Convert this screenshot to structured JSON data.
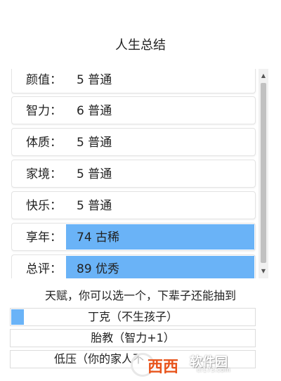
{
  "page": {
    "title": "人生总结"
  },
  "stats": [
    {
      "label": "颜值：",
      "value": "5 普通",
      "highlight": false
    },
    {
      "label": "智力：",
      "value": "6 普通",
      "highlight": false
    },
    {
      "label": "体质：",
      "value": "5 普通",
      "highlight": false
    },
    {
      "label": "家境：",
      "value": "5 普通",
      "highlight": false
    },
    {
      "label": "快乐：",
      "value": "5 普通",
      "highlight": false
    },
    {
      "label": "享年：",
      "value": "74 古稀",
      "highlight": true
    },
    {
      "label": "总评：",
      "value": "89 优秀",
      "highlight": true
    }
  ],
  "talents": {
    "prompt": "天赋，你可以选一个，下辈子还能抽到",
    "options": [
      {
        "label": "丁克（不生孩子）",
        "selected": true
      },
      {
        "label": "胎教（智力+1）",
        "selected": false
      },
      {
        "label": "低压（你的家人不",
        "selected": false
      }
    ]
  },
  "colors": {
    "highlight": "#6ab3f7",
    "border": "#e3e3e3",
    "watermark": "#e8541c"
  },
  "watermark": {
    "text": "软件园",
    "url": "cr173.com"
  }
}
